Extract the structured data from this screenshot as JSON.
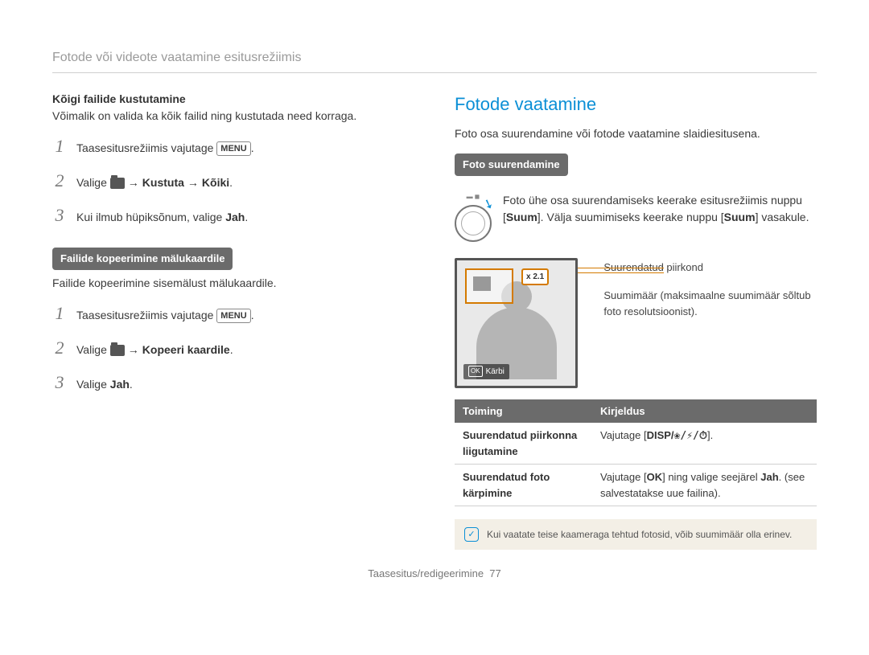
{
  "header": "Fotode või videote vaatamine esitusrežiimis",
  "left": {
    "delete_heading": "Kõigi failide kustutamine",
    "delete_desc": "Võimalik on valida ka kõik failid ning kustutada need korraga.",
    "steps_a": {
      "1a": "Taasesitusrežiimis vajutage ",
      "1b_key": "MENU",
      "1c": ".",
      "2a": "Valige ",
      "2b": " → Kustuta → Kõiki",
      "2c": ".",
      "3a": "Kui ilmub hüpiksõnum, valige ",
      "3b": "Jah",
      "3c": "."
    },
    "copy_pill": "Failide kopeerimine mälukaardile",
    "copy_desc": "Failide kopeerimine sisemälust mälukaardile.",
    "steps_b": {
      "1a": "Taasesitusrežiimis vajutage ",
      "1b_key": "MENU",
      "1c": ".",
      "2a": "Valige ",
      "2b": " → Kopeeri kaardile",
      "2c": ".",
      "3a": "Valige ",
      "3b": "Jah",
      "3c": "."
    }
  },
  "right": {
    "title": "Fotode vaatamine",
    "intro": "Foto osa suurendamine või fotode vaatamine slaidiesitusena.",
    "zoom_pill": "Foto suurendamine",
    "zoom_text_a": "Foto ühe osa suurendamiseks keerake esitusrežiimis nuppu [",
    "zoom_text_b": "Suum",
    "zoom_text_c": "]. Välja suumimiseks keerake nuppu [",
    "zoom_text_d": "Suum",
    "zoom_text_e": "] vasakule.",
    "zoom_badge": "x 2.1",
    "crop_label": "Kärbi",
    "callout1": "Suurendatud piirkond",
    "callout2": "Suumimäär (maksimaalne suumimäär sõltub foto resolutsioonist).",
    "table": {
      "h1": "Toiming",
      "h2": "Kirjeldus",
      "r1c1": "Suurendatud piirkonna liigutamine",
      "r1c2_a": "Vajutage [",
      "r1c2_b": "DISP/",
      "r1c2_glyphs": "❀/⚡/⏱",
      "r1c2_c": "].",
      "r2c1": "Suurendatud foto kärpimine",
      "r2c2_a": "Vajutage ",
      "r2c2_key": "OK",
      "r2c2_b": " ning valige seejärel ",
      "r2c2_c": "Jah",
      "r2c2_d": ". (see salvestatakse uue failina)."
    },
    "note": "Kui vaatate teise kaameraga tehtud fotosid, võib suumimäär olla erinev."
  },
  "footer_a": "Taasesitus/redigeerimine",
  "footer_b": "77"
}
